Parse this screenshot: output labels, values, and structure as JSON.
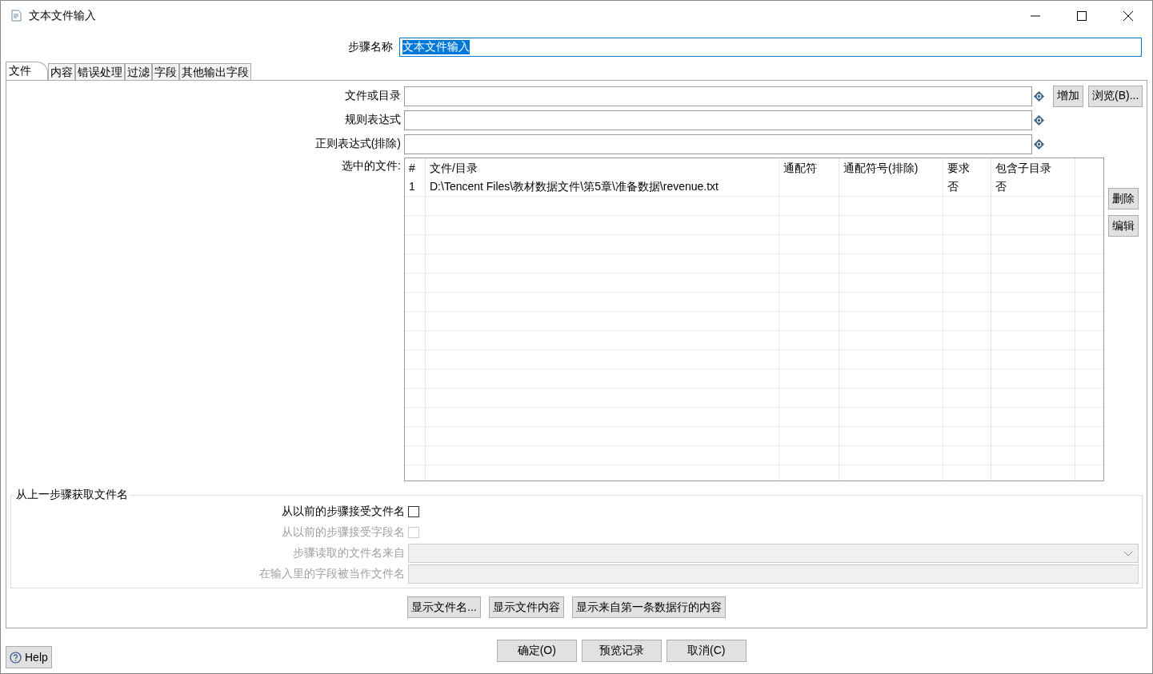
{
  "window": {
    "title": "文本文件输入"
  },
  "step_name": {
    "label": "步骤名称",
    "value": "文本文件输入",
    "highlighted": true
  },
  "tabs": [
    {
      "label": "文件",
      "selected": true
    },
    {
      "label": "内容",
      "selected": false
    },
    {
      "label": "错误处理",
      "selected": false
    },
    {
      "label": "过滤",
      "selected": false
    },
    {
      "label": "字段",
      "selected": false
    },
    {
      "label": "其他输出字段",
      "selected": false
    }
  ],
  "file_fields": [
    {
      "label": "文件或目录"
    },
    {
      "label": "规则表达式"
    },
    {
      "label": "正则表达式(排除)"
    }
  ],
  "add_button": "增加",
  "browse_button": "浏览(B)...",
  "selected_files": {
    "label": "选中的文件:",
    "columns": [
      "#",
      "文件/目录",
      "通配符",
      "通配符号(排除)",
      "要求",
      "包含子目录"
    ],
    "rows": [
      {
        "index": "1",
        "path": "D:\\Tencent Files\\教材数据文件\\第5章\\准备数据\\revenue.txt",
        "required": "否",
        "include_subdirs": "否"
      }
    ]
  },
  "table_buttons": [
    "删除",
    "编辑"
  ],
  "group": {
    "title": "从上一步骤获取文件名",
    "options": [
      {
        "kind": "checkbox",
        "label": "从以前的步骤接受文件名",
        "checked": false,
        "disabled": false
      },
      {
        "kind": "checkbox",
        "label": "从以前的步骤接受字段名",
        "checked": false,
        "disabled": true
      },
      {
        "kind": "dropdown",
        "label": "步骤读取的文件名来自",
        "disabled": true
      },
      {
        "kind": "text",
        "label": "在输入里的字段被当作文件名",
        "disabled": true
      }
    ]
  },
  "show_buttons": [
    "显示文件名...",
    "显示文件内容",
    "显示来自第一条数据行的内容"
  ],
  "help_button": "Help",
  "dialog_buttons": [
    "确定(O)",
    "预览记录",
    "取消(C)"
  ]
}
